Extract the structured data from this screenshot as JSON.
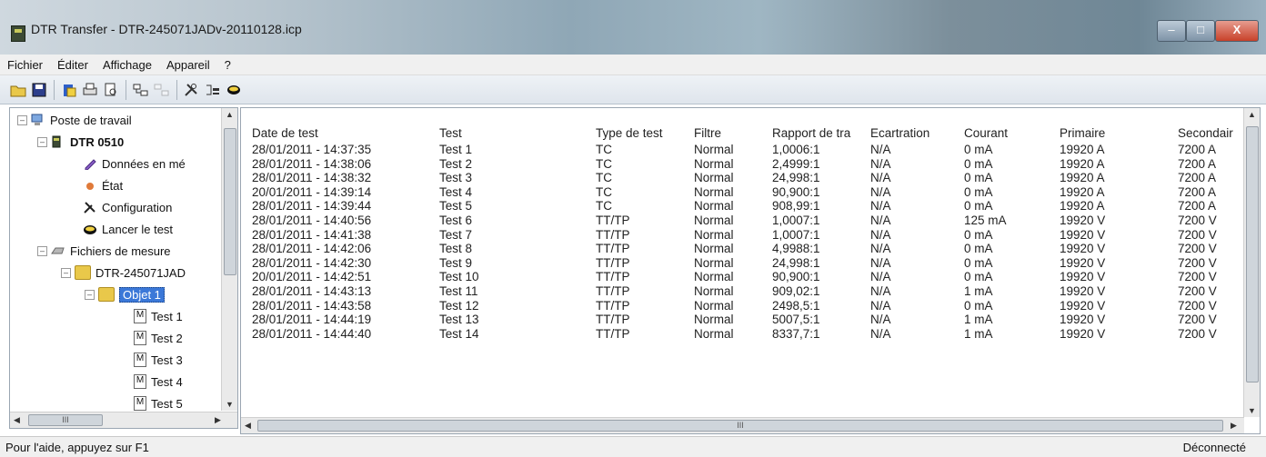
{
  "window": {
    "title": "DTR Transfer - DTR-245071JADv-20110128.icp"
  },
  "menu": [
    "Fichier",
    "Éditer",
    "Affichage",
    "Appareil",
    "?"
  ],
  "toolbar_icons": [
    "open-icon",
    "save-icon",
    "paste-icon",
    "print-icon",
    "print-preview-icon",
    "connect-icon",
    "disconnect-icon",
    "configuration-icon",
    "data-icon",
    "launch-test-icon"
  ],
  "tree": {
    "root": "Poste de travail",
    "device": "DTR 0510",
    "device_items": [
      "Données en mé",
      "État",
      "Configuration",
      "Lancer le test"
    ],
    "measure_files": "Fichiers de mesure",
    "file": "DTR-245071JAD",
    "object": "Objet 1",
    "tests": [
      "Test 1",
      "Test 2",
      "Test 3",
      "Test 4",
      "Test 5"
    ]
  },
  "table": {
    "columns": [
      "Date de test",
      "Test",
      "Type de test",
      "Filtre",
      "Rapport de tra",
      "Ecartration",
      "Courant",
      "Primaire",
      "Secondair"
    ],
    "rows": [
      [
        "28/01/2011 - 14:37:35",
        "Test 1",
        "TC",
        "Normal",
        "1,0006:1",
        "N/A",
        "0 mA",
        "19920 A",
        "7200 A"
      ],
      [
        "28/01/2011 - 14:38:06",
        "Test 2",
        "TC",
        "Normal",
        "2,4999:1",
        "N/A",
        "0 mA",
        "19920 A",
        "7200 A"
      ],
      [
        "28/01/2011 - 14:38:32",
        "Test 3",
        "TC",
        "Normal",
        "24,998:1",
        "N/A",
        "0 mA",
        "19920 A",
        "7200 A"
      ],
      [
        "20/01/2011 - 14:39:14",
        "Test 4",
        "TC",
        "Normal",
        "90,900:1",
        "N/A",
        "0 mA",
        "19920 A",
        "7200 A"
      ],
      [
        "28/01/2011 - 14:39:44",
        "Test 5",
        "TC",
        "Normal",
        "908,99:1",
        "N/A",
        "0 mA",
        "19920 A",
        "7200 A"
      ],
      [
        "28/01/2011 - 14:40:56",
        "Test 6",
        "TT/TP",
        "Normal",
        "1,0007:1",
        "N/A",
        "125 mA",
        "19920 V",
        "7200 V"
      ],
      [
        "28/01/2011 - 14:41:38",
        "Test 7",
        "TT/TP",
        "Normal",
        "1,0007:1",
        "N/A",
        "0 mA",
        "19920 V",
        "7200 V"
      ],
      [
        "28/01/2011 - 14:42:06",
        "Test 8",
        "TT/TP",
        "Normal",
        "4,9988:1",
        "N/A",
        "0 mA",
        "19920 V",
        "7200 V"
      ],
      [
        "28/01/2011 - 14:42:30",
        "Test 9",
        "TT/TP",
        "Normal",
        "24,998:1",
        "N/A",
        "0 mA",
        "19920 V",
        "7200 V"
      ],
      [
        "20/01/2011 - 14:42:51",
        "Test 10",
        "TT/TP",
        "Normal",
        "90,900:1",
        "N/A",
        "0 mA",
        "19920 V",
        "7200 V"
      ],
      [
        "28/01/2011 - 14:43:13",
        "Test 11",
        "TT/TP",
        "Normal",
        "909,02:1",
        "N/A",
        "1 mA",
        "19920 V",
        "7200 V"
      ],
      [
        "28/01/2011 - 14:43:58",
        "Test 12",
        "TT/TP",
        "Normal",
        "2498,5:1",
        "N/A",
        "0 mA",
        "19920 V",
        "7200 V"
      ],
      [
        "28/01/2011 - 14:44:19",
        "Test 13",
        "TT/TP",
        "Normal",
        "5007,5:1",
        "N/A",
        "1 mA",
        "19920 V",
        "7200 V"
      ],
      [
        "28/01/2011 - 14:44:40",
        "Test 14",
        "TT/TP",
        "Normal",
        "8337,7:1",
        "N/A",
        "1 mA",
        "19920 V",
        "7200 V"
      ]
    ]
  },
  "status": {
    "left": "Pour l'aide, appuyez sur F1",
    "right": "Déconnecté"
  }
}
